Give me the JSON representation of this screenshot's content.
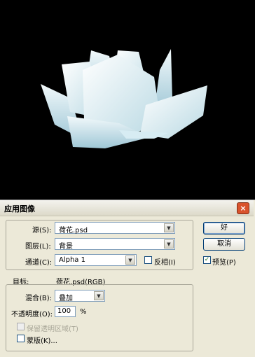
{
  "dialog": {
    "title": "应用图像",
    "close_icon": "×"
  },
  "source": {
    "source_label": "源(S):",
    "source_value": "荷花.psd",
    "layer_label": "图层(L):",
    "layer_value": "背景",
    "channel_label": "通道(C):",
    "channel_value": "Alpha 1",
    "invert_label": "反相(I)",
    "invert_checked": false
  },
  "target": {
    "label": "目标:",
    "value": "荷花.psd(RGB)"
  },
  "blending": {
    "blend_label": "混合(B):",
    "blend_value": "叠加",
    "opacity_label": "不透明度(O):",
    "opacity_value": "100",
    "opacity_unit": "%",
    "preserve_label": "保留透明区域(T)",
    "mask_label": "蒙版(K)..."
  },
  "buttons": {
    "ok": "好",
    "cancel": "取消",
    "preview_label": "预览(P)",
    "preview_checked": true
  },
  "colors": {
    "canvas_bg": "#000000",
    "dialog_bg": "#ece9d8",
    "petal": "#c8e3ee"
  }
}
